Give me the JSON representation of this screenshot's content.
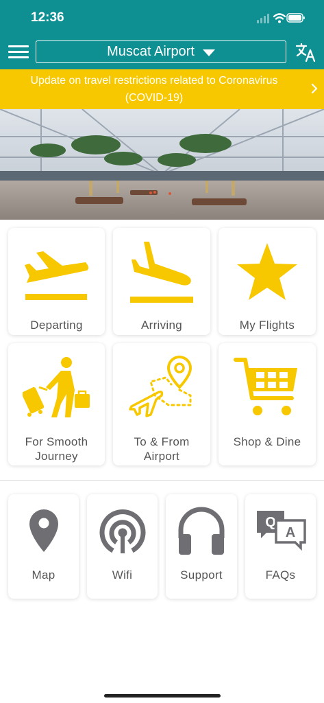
{
  "status_bar": {
    "time": "12:36"
  },
  "header": {
    "airport_name": "Muscat Airport"
  },
  "banner": {
    "text": "Update on travel restrictions related to Coronavirus (COVID-19)"
  },
  "colors": {
    "header": "#0e8f92",
    "banner": "#f7c800",
    "icon_primary": "#f7c800",
    "icon_secondary": "#6e6e73"
  },
  "main_tiles": [
    {
      "label": "Departing",
      "icon": "plane-departing-icon"
    },
    {
      "label": "Arriving",
      "icon": "plane-arriving-icon"
    },
    {
      "label": "My Flights",
      "icon": "star-icon"
    },
    {
      "label_line1": "For Smooth",
      "label_line2": "Journey",
      "icon": "traveler-luggage-icon"
    },
    {
      "label_line1": "To & From",
      "label_line2": "Airport",
      "icon": "route-plane-icon"
    },
    {
      "label": "Shop & Dine",
      "icon": "shopping-cart-icon"
    }
  ],
  "utility_tiles": [
    {
      "label": "Map",
      "icon": "map-pin-icon"
    },
    {
      "label": "Wifi",
      "icon": "wifi-icon"
    },
    {
      "label": "Support",
      "icon": "headphones-icon"
    },
    {
      "label": "FAQs",
      "icon": "qa-bubbles-icon"
    }
  ]
}
